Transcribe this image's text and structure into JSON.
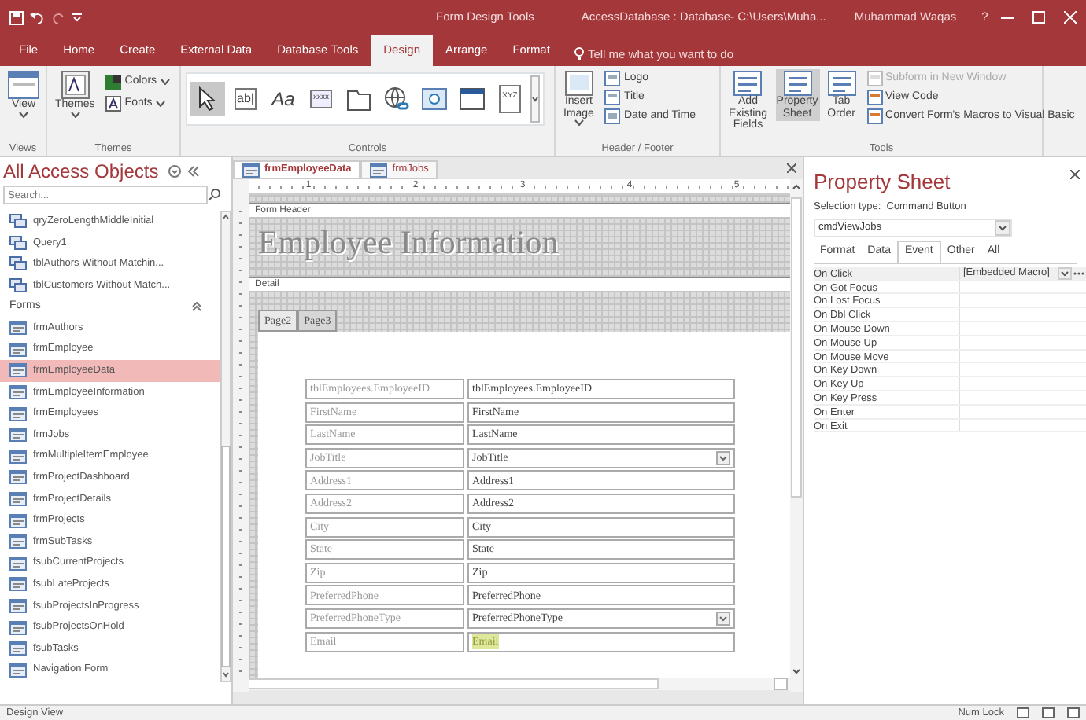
{
  "title_bar": {
    "context": "Form Design Tools",
    "title": "AccessDatabase : Database- C:\\Users\\Muha...",
    "user": "Muhammad Waqas",
    "help": "?"
  },
  "ribbon_tabs": [
    {
      "label": "File",
      "selected": false
    },
    {
      "label": "Home",
      "selected": false
    },
    {
      "label": "Create",
      "selected": false
    },
    {
      "label": "External Data",
      "selected": false
    },
    {
      "label": "Database Tools",
      "selected": false
    },
    {
      "label": "Design",
      "selected": true
    },
    {
      "label": "Arrange",
      "selected": false
    },
    {
      "label": "Format",
      "selected": false
    }
  ],
  "tell_me": "Tell me what you want to do",
  "ribbon": {
    "views": {
      "label": "Views",
      "view_button": "View"
    },
    "themes": {
      "label": "Themes",
      "themes_button": "Themes",
      "colors": "Colors",
      "fonts": "Fonts"
    },
    "controls": {
      "label": "Controls",
      "tools": [
        {
          "kind": "pointer",
          "selected": true
        },
        {
          "kind": "textbox",
          "glyph": "ab|",
          "selected": false
        },
        {
          "kind": "label",
          "glyph": "Aa",
          "selected": false
        },
        {
          "kind": "button",
          "glyph": "xxxx",
          "selected": false
        },
        {
          "kind": "tab",
          "selected": false
        },
        {
          "kind": "hyperlink",
          "selected": false
        },
        {
          "kind": "browser",
          "selected": false
        },
        {
          "kind": "navigation",
          "selected": false
        },
        {
          "kind": "optiongroup",
          "glyph": "XYZ",
          "selected": false
        }
      ]
    },
    "header_footer": {
      "label": "Header / Footer",
      "insert_image": [
        "Insert",
        "Image"
      ],
      "items": [
        "Logo",
        "Title",
        "Date and Time"
      ]
    },
    "tools": {
      "label": "Tools",
      "large": [
        {
          "label": "Add Existing Fields",
          "selected": false
        },
        {
          "label": "Property Sheet",
          "selected": true
        },
        {
          "label": "Tab Order",
          "selected": false
        }
      ],
      "small": [
        {
          "label": "Subform in New Window",
          "disabled": true
        },
        {
          "label": "View Code",
          "disabled": false
        },
        {
          "label": "Convert Form's Macros to Visual Basic",
          "disabled": false
        }
      ]
    }
  },
  "nav": {
    "title": "All Access Objects",
    "search_placeholder": "Search...",
    "rows": [
      {
        "kind": "query",
        "label": "qryZeroLengthMiddleInitial",
        "selected": false
      },
      {
        "kind": "query",
        "label": "Query1",
        "selected": false
      },
      {
        "kind": "query",
        "label": "tblAuthors Without Matchin...",
        "selected": false
      },
      {
        "kind": "query",
        "label": "tblCustomers Without Match...",
        "selected": false
      },
      {
        "kind": "group",
        "label": "Forms",
        "selected": false
      },
      {
        "kind": "form",
        "label": "frmAuthors",
        "selected": false
      },
      {
        "kind": "form",
        "label": "frmEmployee",
        "selected": false
      },
      {
        "kind": "form",
        "label": "frmEmployeeData",
        "selected": true
      },
      {
        "kind": "form",
        "label": "frmEmployeeInformation",
        "selected": false
      },
      {
        "kind": "form",
        "label": "frmEmployees",
        "selected": false
      },
      {
        "kind": "form",
        "label": "frmJobs",
        "selected": false
      },
      {
        "kind": "form",
        "label": "frmMultipleItemEmployee",
        "selected": false
      },
      {
        "kind": "form",
        "label": "frmProjectDashboard",
        "selected": false
      },
      {
        "kind": "form",
        "label": "frmProjectDetails",
        "selected": false
      },
      {
        "kind": "form",
        "label": "frmProjects",
        "selected": false
      },
      {
        "kind": "form",
        "label": "frmSubTasks",
        "selected": false
      },
      {
        "kind": "form",
        "label": "fsubCurrentProjects",
        "selected": false
      },
      {
        "kind": "form",
        "label": "fsubLateProjects",
        "selected": false
      },
      {
        "kind": "form",
        "label": "fsubProjectsInProgress",
        "selected": false
      },
      {
        "kind": "form",
        "label": "fsubProjectsOnHold",
        "selected": false
      },
      {
        "kind": "form",
        "label": "fsubTasks",
        "selected": false
      },
      {
        "kind": "form",
        "label": "Navigation Form",
        "selected": false
      }
    ]
  },
  "documents": [
    {
      "label": "frmEmployeeData",
      "selected": true
    },
    {
      "label": "frmJobs",
      "selected": false
    }
  ],
  "ruler": [
    "1",
    "2",
    "3",
    "4",
    "5"
  ],
  "form": {
    "header_section": "Form Header",
    "title": "Employee Information",
    "detail_section": "Detail",
    "pages": [
      {
        "label": "Page2",
        "selected": true
      },
      {
        "label": "Page3",
        "selected": false
      }
    ],
    "fields": [
      {
        "label": "tblEmployees.EmployeeID",
        "control": "tblEmployees.EmployeeID",
        "kind": "text",
        "highlighted": false
      },
      {
        "label": "FirstName",
        "control": "FirstName",
        "kind": "text",
        "highlighted": false
      },
      {
        "label": "LastName",
        "control": "LastName",
        "kind": "text",
        "highlighted": false
      },
      {
        "label": "JobTitle",
        "control": "JobTitle",
        "kind": "combo",
        "highlighted": false
      },
      {
        "label": "Address1",
        "control": "Address1",
        "kind": "text",
        "highlighted": false
      },
      {
        "label": "Address2",
        "control": "Address2",
        "kind": "text",
        "highlighted": false
      },
      {
        "label": "City",
        "control": "City",
        "kind": "text",
        "highlighted": false
      },
      {
        "label": "State",
        "control": "State",
        "kind": "text",
        "highlighted": false
      },
      {
        "label": "Zip",
        "control": "Zip",
        "kind": "text",
        "highlighted": false
      },
      {
        "label": "PreferredPhone",
        "control": "PreferredPhone",
        "kind": "text",
        "highlighted": false
      },
      {
        "label": "PreferredPhoneType",
        "control": "PreferredPhoneType",
        "kind": "combo",
        "highlighted": false
      },
      {
        "label": "Email",
        "control": "Email",
        "kind": "text",
        "highlighted": true
      }
    ]
  },
  "property_sheet": {
    "title": "Property Sheet",
    "selection_type": "Selection type:  Command Button",
    "object": "cmdViewJobs",
    "tabs": [
      {
        "label": "Format",
        "selected": false
      },
      {
        "label": "Data",
        "selected": false
      },
      {
        "label": "Event",
        "selected": true
      },
      {
        "label": "Other",
        "selected": false
      },
      {
        "label": "All",
        "selected": false
      }
    ],
    "rows": [
      {
        "name": "On Click",
        "value": "[Embedded Macro]",
        "selected": true
      },
      {
        "name": "On Got Focus",
        "selected": false
      },
      {
        "name": "On Lost Focus",
        "selected": false
      },
      {
        "name": "On Dbl Click",
        "selected": false
      },
      {
        "name": "On Mouse Down",
        "selected": false
      },
      {
        "name": "On Mouse Up",
        "selected": false
      },
      {
        "name": "On Mouse Move",
        "selected": false
      },
      {
        "name": "On Key Down",
        "selected": false
      },
      {
        "name": "On Key Up",
        "selected": false
      },
      {
        "name": "On Key Press",
        "selected": false
      },
      {
        "name": "On Enter",
        "selected": false
      },
      {
        "name": "On Exit",
        "selected": false
      }
    ]
  },
  "status_bar": {
    "mode": "Design View",
    "num_lock": "Num Lock"
  }
}
